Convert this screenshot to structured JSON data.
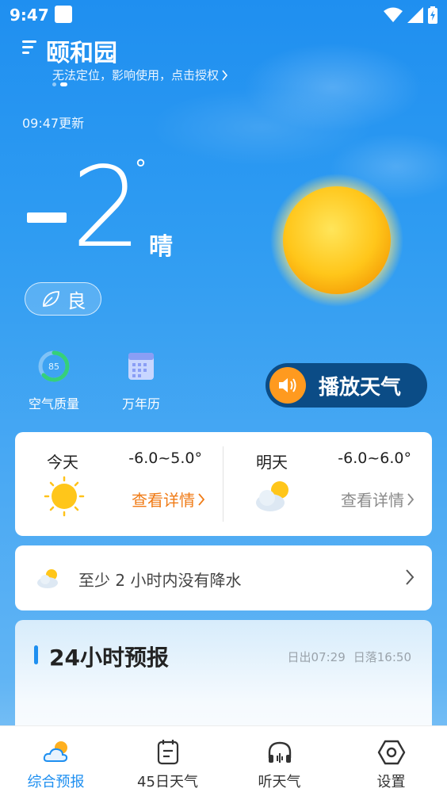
{
  "status_bar": {
    "time": "9:47"
  },
  "header": {
    "city": "颐和园",
    "location_hint": "无法定位，影响使用，点击授权",
    "update_time": "09:47更新"
  },
  "current": {
    "temperature": "2",
    "degree_symbol": "°",
    "condition": "晴",
    "aqi_label": "良"
  },
  "tools": {
    "aqi_label": "空气质量",
    "aqi_value": "85",
    "calendar_label": "万年历"
  },
  "play_button": {
    "label": "播放天气"
  },
  "forecast": {
    "today": {
      "day": "今天",
      "range": "-6.0~5.0°",
      "detail": "查看详情"
    },
    "tomorrow": {
      "day": "明天",
      "range": "-6.0~6.0°",
      "detail": "查看详情"
    }
  },
  "precip": {
    "text": "至少 2 小时内没有降水"
  },
  "hourly": {
    "title": "24小时预报",
    "sunrise": "日出07:29",
    "sunset": "日落16:50"
  },
  "nav": {
    "items": [
      {
        "label": "综合预报",
        "active": true
      },
      {
        "label": "45日天气",
        "active": false
      },
      {
        "label": "听天气",
        "active": false
      },
      {
        "label": "设置",
        "active": false
      }
    ]
  },
  "colors": {
    "accent_blue": "#1e8ff0",
    "orange": "#f07b16",
    "play_bg": "#0b4c86",
    "speaker_orange": "#ff9a1f"
  }
}
